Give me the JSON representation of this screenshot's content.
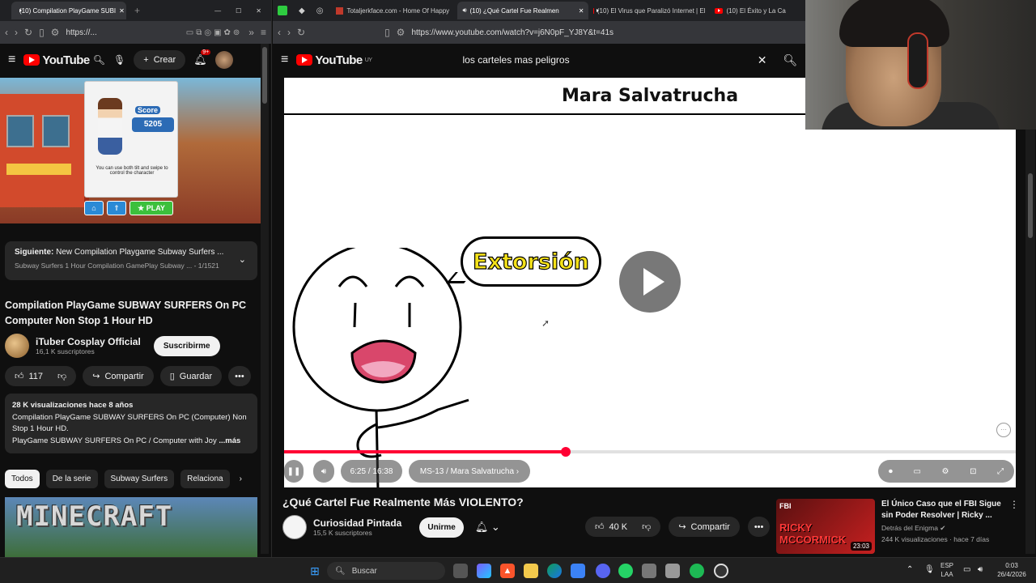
{
  "left_browser": {
    "tabs": [
      {
        "title": "(10) Compilation PlayGame SUBI"
      }
    ],
    "url": "https://...",
    "yt_region": "",
    "create_label": "Crear",
    "notif_count": "9+",
    "thumb": {
      "score_label": "Score",
      "score_value": "5205",
      "help_text": "You can use both tilt and swipe to control the character",
      "play_label": "PLAY"
    },
    "next": {
      "prefix": "Siguiente:",
      "title": "New Compilation Playgame Subway Surfers ...",
      "sub": "Subway Surfers 1 Hour Compilation GamePlay Subway ... - 1/1521"
    },
    "video_title": "Compilation PlayGame SUBWAY SURFERS On PC Computer Non Stop 1 Hour HD",
    "channel": {
      "name": "iTuber Cosplay Official",
      "subs": "16,1 K suscriptores",
      "subscribe": "Suscribirme"
    },
    "actions": {
      "likes": "117",
      "share": "Compartir",
      "save": "Guardar"
    },
    "description": {
      "stats": "28 K visualizaciones  hace 8 años",
      "line1": "Compilation PlayGame SUBWAY SURFERS On PC (Computer) Non Stop 1 Hour HD.",
      "line2": "PlayGame SUBWAY SURFERS On PC / Computer with Joy",
      "more": "...más"
    },
    "chips": [
      "Todos",
      "De la serie",
      "Subway Surfers",
      "Relaciona"
    ],
    "rec_thumb_text": "MINECRAFT"
  },
  "right_browser": {
    "tabs": [
      {
        "title": "Totaljerkface.com - Home Of Happy"
      },
      {
        "title": "(10) ¿Qué Cartel Fue Realmen"
      },
      {
        "title": "(10) El Virus que Paralizó Internet | El"
      },
      {
        "title": "(10) El Éxito y La Ca"
      }
    ],
    "url": "https://www.youtube.com/watch?v=j6N0pF_YJ8Y&t=41s",
    "yt_region": "UY",
    "search_value": "los carteles mas peligros",
    "video": {
      "heading": "Mara Salvatrucha",
      "bubble": "Extorsión",
      "time": "6:25 / 16:38",
      "chapter": "MS-13 / Mara Salvatrucha",
      "progress": 0.385
    },
    "video_title": "¿Qué Cartel Fue Realmente Más VIOLENTO?",
    "channel": {
      "name": "Curiosidad Pintada",
      "subs": "15,5 K suscriptores",
      "join": "Unirme"
    },
    "actions": {
      "likes": "40 K",
      "share": "Compartir"
    },
    "recommendation": {
      "title": "El Único Caso que el FBI Sigue sin Poder Resolver | Ricky ...",
      "channel": "Detrás del Enigma",
      "meta": "244 K visualizaciones · hace 7 días",
      "duration": "23:03",
      "thumb_text": "RICKY MCCORMICK"
    }
  },
  "taskbar": {
    "search": "Buscar",
    "lang": "ESP",
    "lang2": "LAA",
    "time": "0:03",
    "date": "26/4/2026"
  },
  "colors": {
    "yt_red": "#ff0000",
    "progress_red": "#ff0033",
    "bg": "#0f0f0f",
    "bubble_text": "#f5e21a"
  }
}
